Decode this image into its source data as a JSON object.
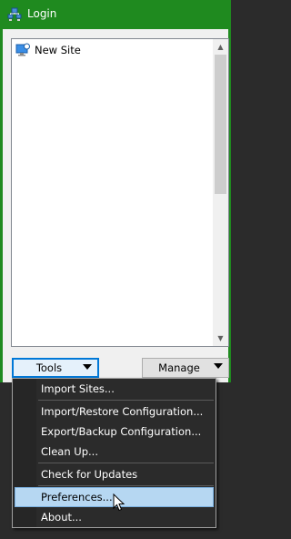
{
  "window": {
    "title": "Login"
  },
  "sites": [
    {
      "label": "New Site"
    }
  ],
  "buttons": {
    "tools": "Tools",
    "manage": "Manage"
  },
  "tools_menu": [
    {
      "label": "Import Sites...",
      "highlighted": false
    },
    {
      "label": "Import/Restore Configuration...",
      "highlighted": false
    },
    {
      "label": "Export/Backup Configuration...",
      "highlighted": false
    },
    {
      "label": "Clean Up...",
      "highlighted": false
    },
    {
      "label": "Check for Updates",
      "highlighted": false
    },
    {
      "label": "Preferences...",
      "highlighted": true
    },
    {
      "label": "About...",
      "highlighted": false
    }
  ],
  "icons": {
    "title": "network-computer-icon",
    "site": "monitor-globe-icon"
  },
  "colors": {
    "titlebar": "#1f8a1f",
    "focus": "#0078d7",
    "menu_highlight": "#b6d7f2"
  }
}
